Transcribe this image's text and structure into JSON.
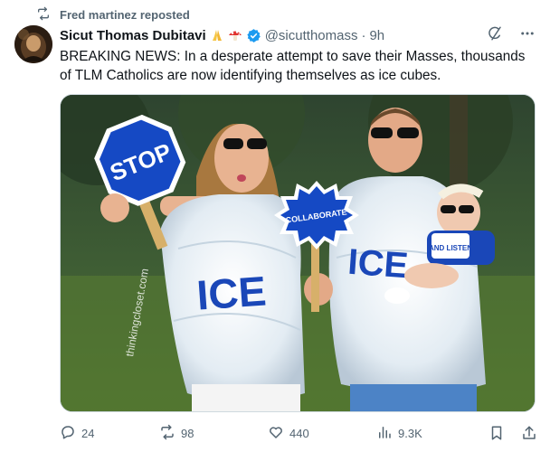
{
  "repost": {
    "text": "Fred martinez reposted",
    "icon": "repost-icon"
  },
  "author": {
    "name": "Sicut Thomas Dubitavi",
    "badges": [
      "praying-hands-emoji",
      "mushroom-emoji"
    ],
    "verified": true,
    "handle": "@sicutthomass",
    "separator": "·",
    "time": "9h"
  },
  "tweet": {
    "text": "BREAKING NEWS: In a desperate attempt to save their Masses, thousands of TLM Catholics are now identifying themselves as ice cubes."
  },
  "media": {
    "stop_sign": "STOP",
    "collaborate_sign": "COLLABORATE",
    "costume_text_woman": "ICE",
    "costume_text_man": "ICE",
    "baby_tag": "AND LISTEN",
    "watermark": "thinkingcloset.com"
  },
  "actions": {
    "replies": "24",
    "reposts": "98",
    "likes": "440",
    "views": "9.3K"
  },
  "colors": {
    "accent": "#1d9bf0",
    "muted": "#536471",
    "sign_blue": "#1549c4"
  }
}
